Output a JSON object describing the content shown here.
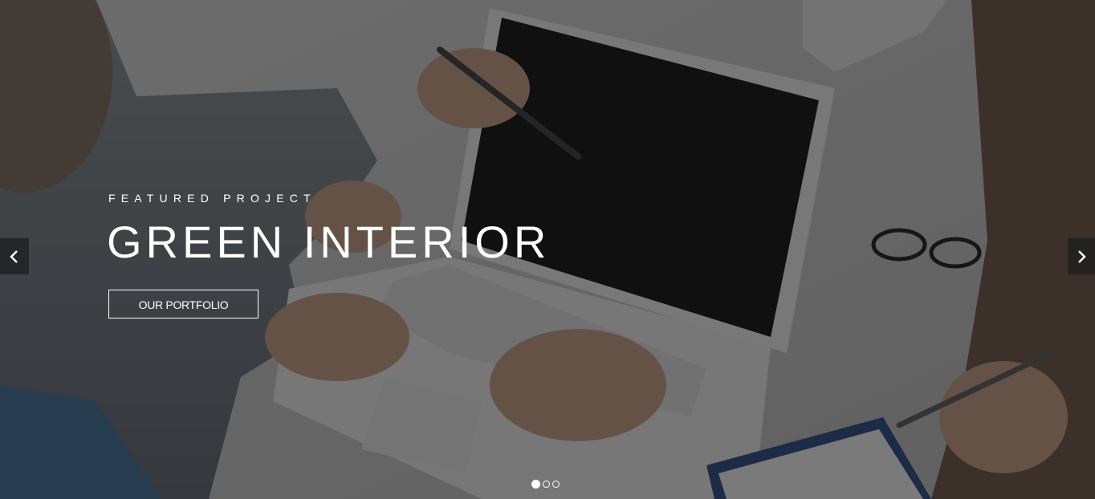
{
  "slider": {
    "eyebrow": "FEATURED PROJECT",
    "title": "GREEN INTERIOR",
    "cta_label": "OUR PORTFOLIO",
    "prev_icon": "chevron-left-icon",
    "next_icon": "chevron-right-icon",
    "pagination": {
      "total": 3,
      "active": 1
    }
  },
  "colors": {
    "text": "#ffffff",
    "overlay": "#141414",
    "arrow_bg": "#1e1e1e"
  }
}
